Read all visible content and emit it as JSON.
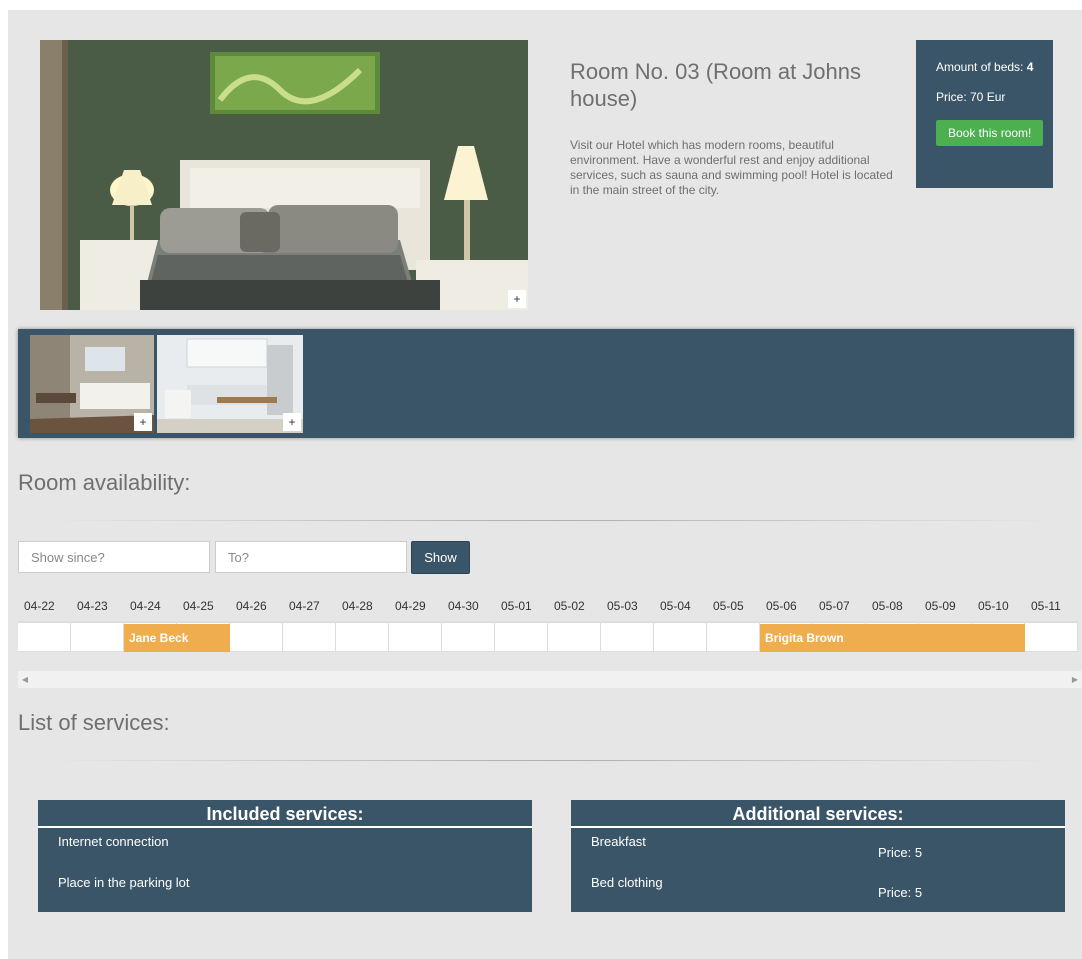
{
  "room": {
    "title": "Room No. 03 (Room at Johns house)",
    "description": "Visit our Hotel which has modern rooms, beautiful environment. Have a wonderful rest and enjoy additional services, such as sauna and swimming pool! Hotel is located in the main street of the city.",
    "beds_label": "Amount of beds:",
    "beds_value": "4",
    "price_label": "Price: 70 Eur",
    "book_label": "Book this room!"
  },
  "gallery": {
    "zoom_symbol": "+"
  },
  "availability": {
    "title": "Room availability:",
    "since_placeholder": "Show since?",
    "to_placeholder": "To?",
    "show_label": "Show",
    "dates": [
      "04-22",
      "04-23",
      "04-24",
      "04-25",
      "04-26",
      "04-27",
      "04-28",
      "04-29",
      "04-30",
      "05-01",
      "05-02",
      "05-03",
      "05-04",
      "05-05",
      "05-06",
      "05-07",
      "05-08",
      "05-09",
      "05-10",
      "05-11"
    ],
    "bookings": [
      {
        "name": "Jane Beck",
        "from": "04-24",
        "to": "04-25"
      },
      {
        "name": "Brigita Brown",
        "from": "05-06",
        "to": "05-10"
      }
    ]
  },
  "services": {
    "title": "List of services:",
    "included": {
      "title": "Included services:",
      "items": [
        "Internet connection",
        "Place in the parking lot"
      ]
    },
    "additional": {
      "title": "Additional services:",
      "items": [
        {
          "name": "Breakfast",
          "price": "Price: 5"
        },
        {
          "name": "Bed clothing",
          "price": "Price: 5"
        }
      ]
    }
  },
  "colors": {
    "panel": "#3b5568",
    "book_button": "#4caf50",
    "booking": "#f0ad4e",
    "page_bg": "#e6e6e6"
  }
}
